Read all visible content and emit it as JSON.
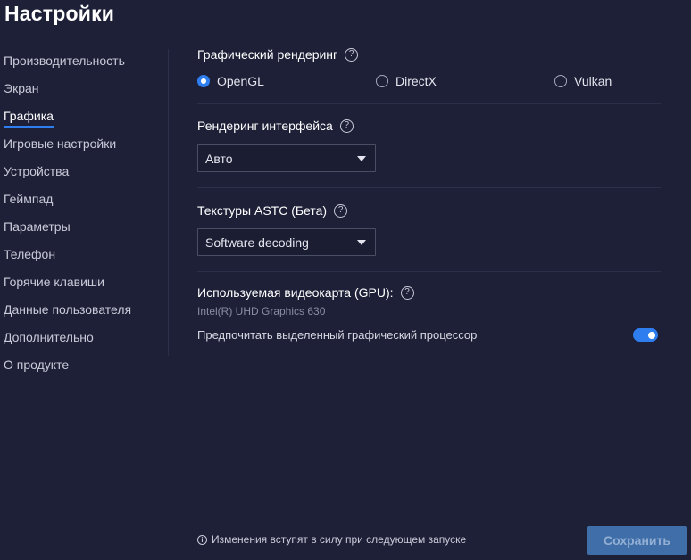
{
  "page_title": "Настройки",
  "sidebar": {
    "items": [
      {
        "label": "Производительность"
      },
      {
        "label": "Экран"
      },
      {
        "label": "Графика",
        "active": true
      },
      {
        "label": "Игровые настройки"
      },
      {
        "label": "Устройства"
      },
      {
        "label": "Геймпад"
      },
      {
        "label": "Параметры"
      },
      {
        "label": "Телефон"
      },
      {
        "label": "Горячие клавиши"
      },
      {
        "label": "Данные пользователя"
      },
      {
        "label": "Дополнительно"
      },
      {
        "label": "О продукте"
      }
    ]
  },
  "graphics_rendering": {
    "title": "Графический рендеринг",
    "options": [
      {
        "label": "OpenGL",
        "checked": true
      },
      {
        "label": "DirectX",
        "checked": false
      },
      {
        "label": "Vulkan",
        "checked": false
      }
    ]
  },
  "interface_rendering": {
    "title": "Рендеринг интерфейса",
    "value": "Авто"
  },
  "astc_textures": {
    "title": "Текстуры ASTC (Бета)",
    "value": "Software decoding"
  },
  "gpu": {
    "title": "Используемая видеокарта (GPU):",
    "name": "Intel(R) UHD Graphics 630",
    "prefer_dedicated_label": "Предпочитать выделенный графический процессор",
    "prefer_dedicated_on": true
  },
  "help_glyph": "?",
  "footer": {
    "info_glyph": "i",
    "note": "Изменения вступят в силу при следующем запуске",
    "save_label": "Сохранить"
  },
  "colors": {
    "background": "#1e2038",
    "accent": "#2f7ef0",
    "save_button": "#3f6ea8"
  }
}
